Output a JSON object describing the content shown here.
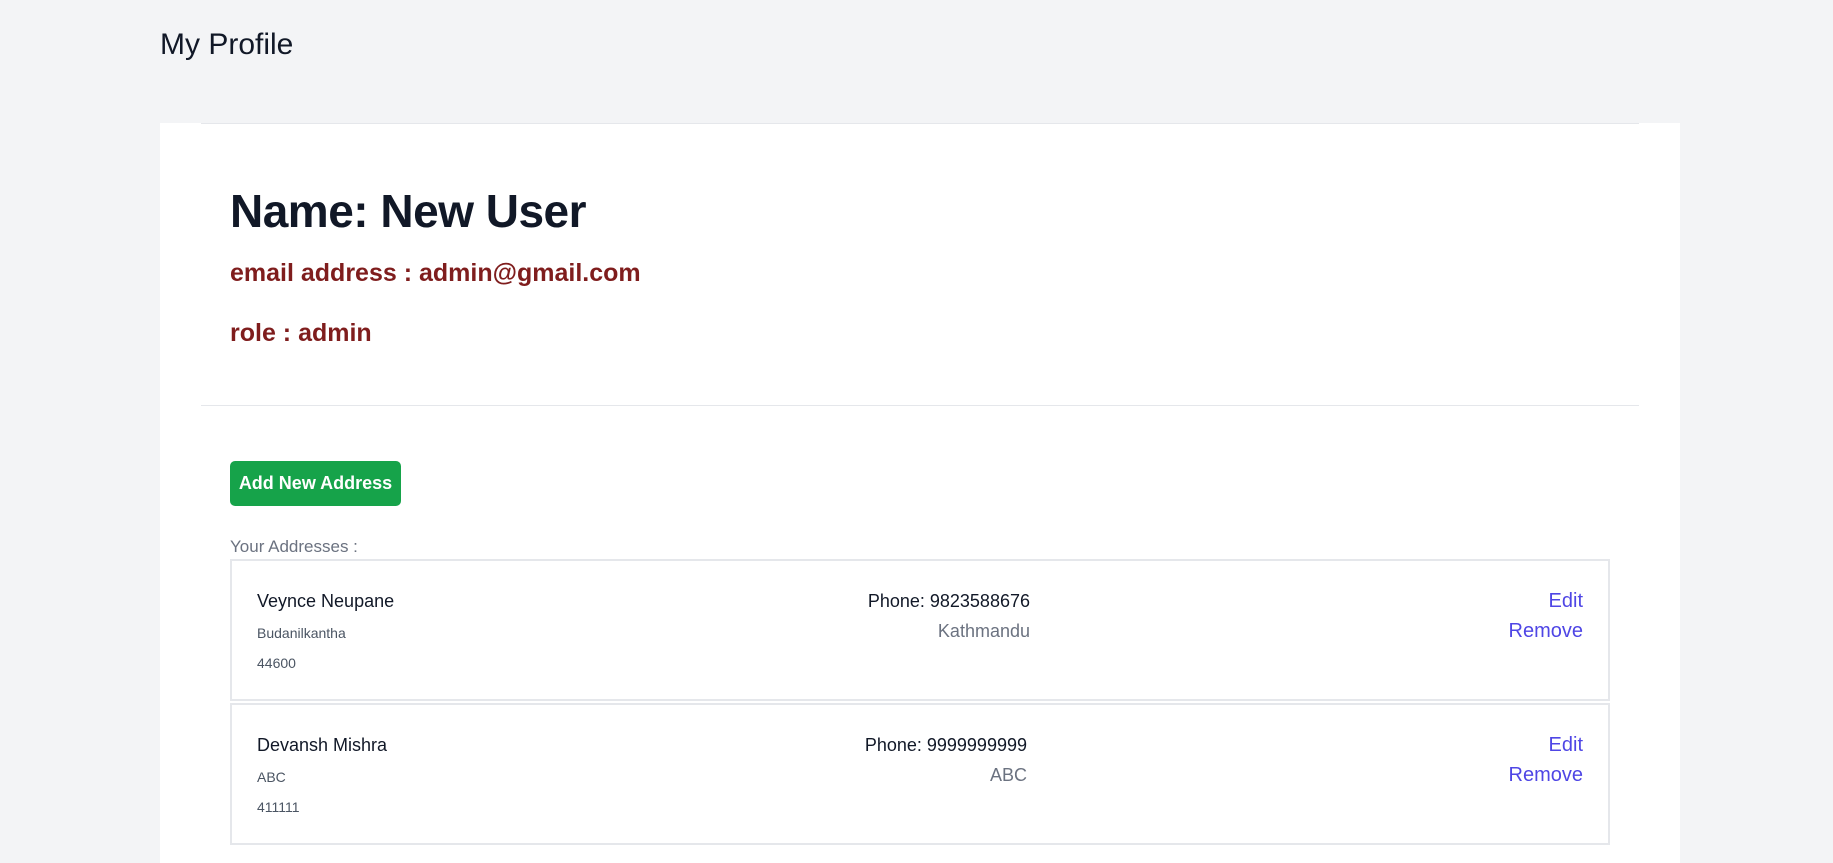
{
  "page": {
    "title": "My Profile"
  },
  "profile": {
    "name_line": "Name: New User",
    "email_line": "email address : admin@gmail.com",
    "role_line": "role : admin"
  },
  "addresses_section": {
    "add_button_label": "Add New Address",
    "list_label": "Your Addresses :",
    "items": [
      {
        "name": "Veynce Neupane",
        "street": "Budanilkantha",
        "pincode": "44600",
        "phone": "Phone: 9823588676",
        "city": "Kathmandu",
        "edit_label": "Edit",
        "remove_label": "Remove"
      },
      {
        "name": "Devansh Mishra",
        "street": "ABC",
        "pincode": "411111",
        "phone": "Phone: 9999999999",
        "city": "ABC",
        "edit_label": "Edit",
        "remove_label": "Remove"
      }
    ]
  },
  "colors": {
    "page_background": "#f3f4f6",
    "card_background": "#ffffff",
    "heading_text": "#111827",
    "accent_text": "#7f1d1d",
    "button_green": "#16a34a",
    "link_indigo": "#4f46e5",
    "muted_text": "#6b7280",
    "border": "#e5e7eb"
  }
}
